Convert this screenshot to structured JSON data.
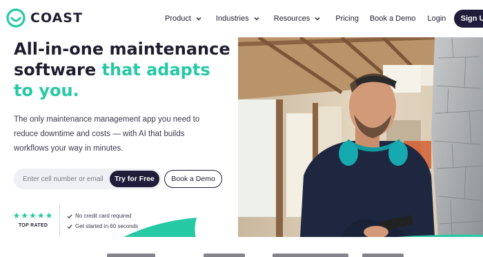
{
  "brand": {
    "name": "COAST",
    "accent_color": "#25c9a4",
    "dark_color": "#1f1d3a",
    "logo_icon": "coast-logo-icon"
  },
  "nav": {
    "items": [
      {
        "label": "Product",
        "has_dropdown": true
      },
      {
        "label": "Industries",
        "has_dropdown": true
      },
      {
        "label": "Resources",
        "has_dropdown": true
      },
      {
        "label": "Pricing",
        "has_dropdown": false
      },
      {
        "label": "Book a Demo",
        "has_dropdown": false
      },
      {
        "label": "Login",
        "has_dropdown": false
      }
    ],
    "signup_label": "Sign Up"
  },
  "hero": {
    "title_part1": "All-in-one maintenance software ",
    "title_accent": "that adapts to you.",
    "subtitle": "The only maintenance management app you need to reduce downtime and costs — with AI that builds workflows your way in minutes.",
    "phone_placeholder": "Enter cell number or email",
    "try_label": "Try for Free",
    "demo_label": "Book a Demo"
  },
  "trust": {
    "stars": 5,
    "stars_text": "★★★★★",
    "rating_label": "TOP RATED",
    "checks": [
      "No credit card required",
      "Get started in 60 seconds"
    ]
  }
}
